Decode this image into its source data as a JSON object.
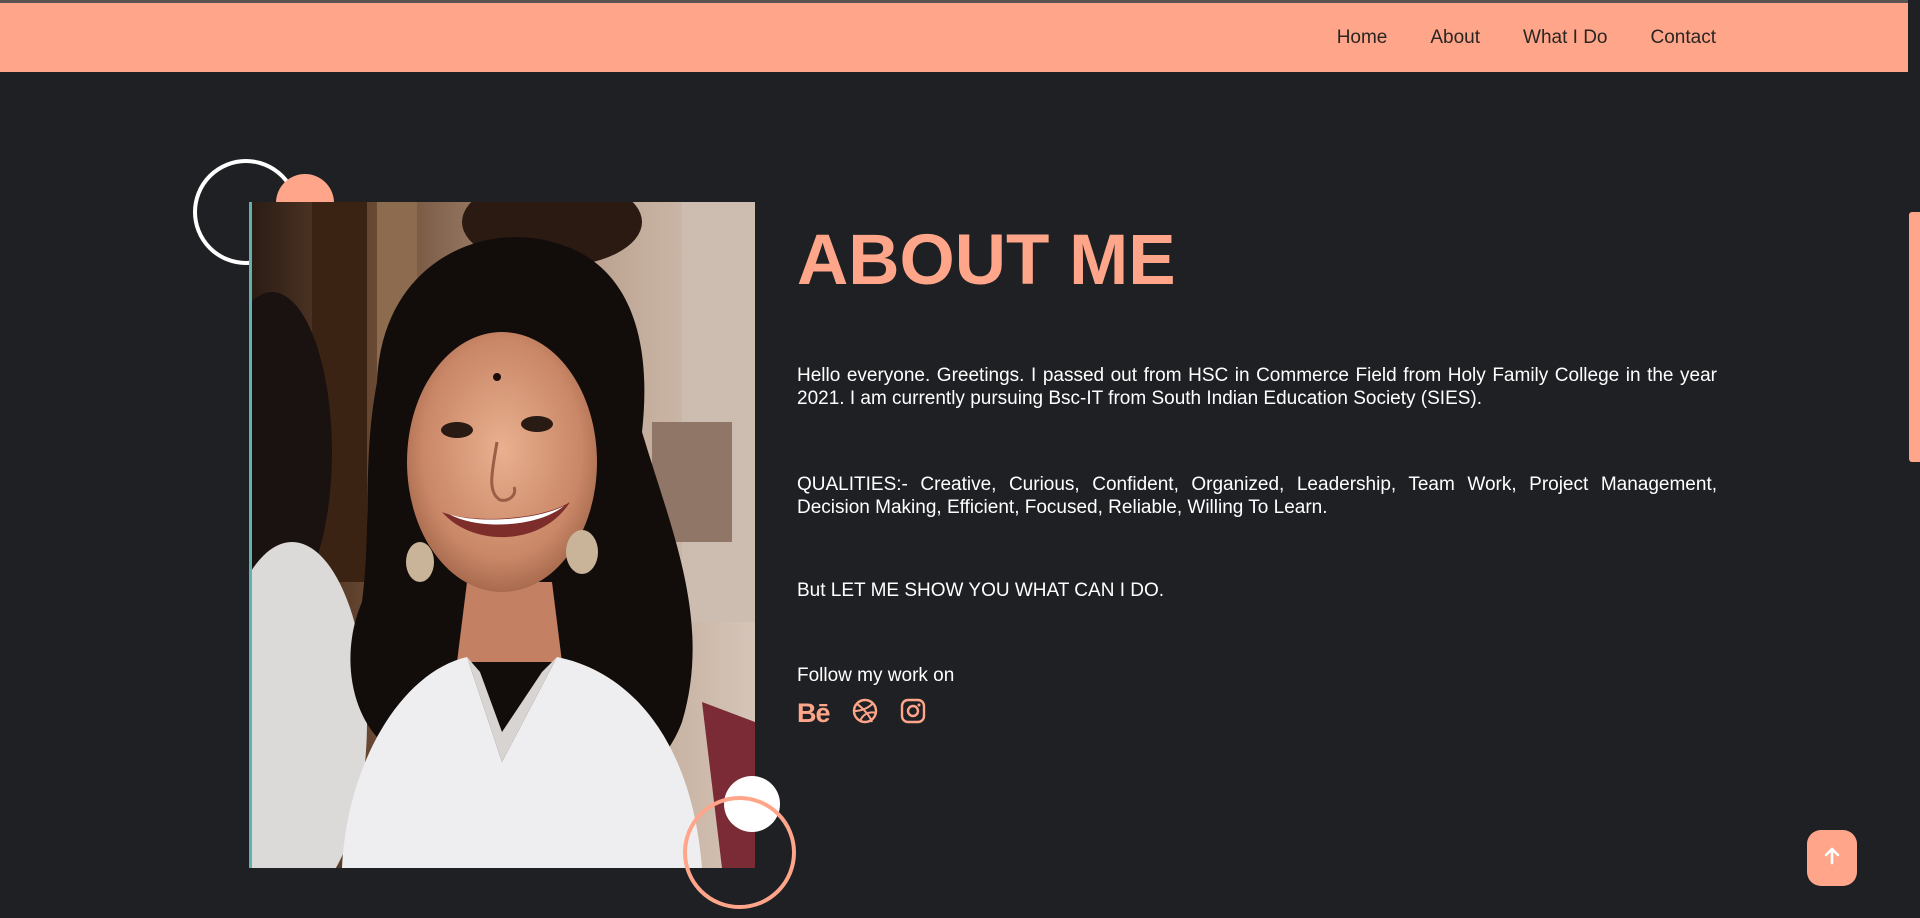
{
  "nav": {
    "items": [
      {
        "label": "Home"
      },
      {
        "label": "About"
      },
      {
        "label": "What I Do"
      },
      {
        "label": "Contact"
      }
    ]
  },
  "about": {
    "title": "ABOUT ME",
    "paragraph_1": "Hello everyone. Greetings. I passed out from HSC in Commerce Field from Holy Family College in the year 2021. I am currently pursuing Bsc-IT from South Indian Education Society (SIES).",
    "paragraph_2": "QUALITIES:- Creative, Curious, Confident, Organized, Leadership, Team Work, Project Management, Decision Making, Efficient, Focused, Reliable, Willing To Learn.",
    "paragraph_3": "But LET ME SHOW YOU WHAT CAN I DO.",
    "follow_label": "Follow my work on",
    "socials": [
      {
        "icon": "behance-icon",
        "glyph": "Bē"
      },
      {
        "icon": "dribbble-icon"
      },
      {
        "icon": "instagram-icon"
      }
    ]
  },
  "colors": {
    "accent": "#ffa68a",
    "background": "#1f2024",
    "text": "#ffffff"
  }
}
